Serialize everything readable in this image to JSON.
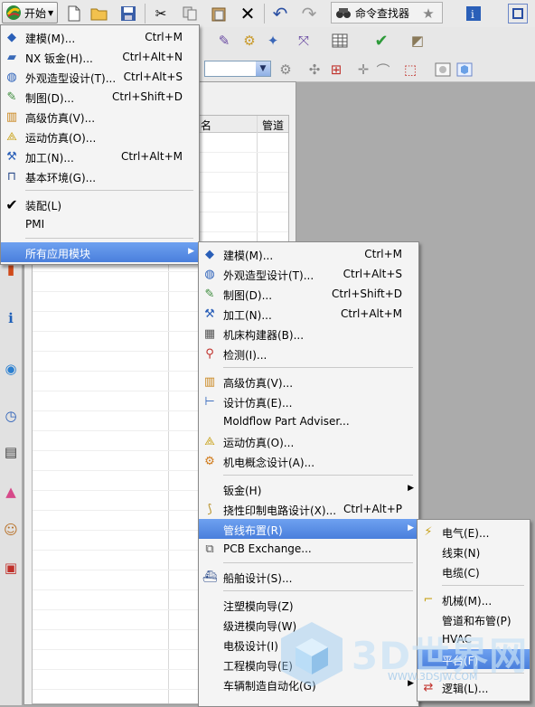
{
  "toolbar": {
    "start_label": "开始",
    "command_finder_label": "命令查找器"
  },
  "navigator": {
    "columns": [
      "名",
      "管道"
    ]
  },
  "start_menu": {
    "items": [
      {
        "label": "建模(M)...",
        "shortcut": "Ctrl+M",
        "icon": "modeling-icon"
      },
      {
        "label": "NX 钣金(H)...",
        "shortcut": "Ctrl+Alt+N",
        "icon": "sheet-metal-icon"
      },
      {
        "label": "外观造型设计(T)...",
        "shortcut": "Ctrl+Alt+S",
        "icon": "shape-studio-icon"
      },
      {
        "label": "制图(D)...",
        "shortcut": "Ctrl+Shift+D",
        "icon": "drafting-icon"
      },
      {
        "label": "高级仿真(V)...",
        "shortcut": "",
        "icon": "advanced-simulation-icon"
      },
      {
        "label": "运动仿真(O)...",
        "shortcut": "",
        "icon": "motion-simulation-icon"
      },
      {
        "label": "加工(N)...",
        "shortcut": "Ctrl+Alt+M",
        "icon": "manufacturing-icon"
      },
      {
        "label": "基本环境(G)...",
        "shortcut": "",
        "icon": "gateway-icon"
      },
      {
        "label": "装配(L)",
        "shortcut": "",
        "icon": "checkmark-icon"
      },
      {
        "label": "PMI",
        "shortcut": "",
        "icon": ""
      },
      {
        "label": "所有应用模块",
        "shortcut": "",
        "icon": ""
      }
    ]
  },
  "apps_menu": {
    "items": [
      {
        "label": "建模(M)...",
        "shortcut": "Ctrl+M"
      },
      {
        "label": "外观造型设计(T)...",
        "shortcut": "Ctrl+Alt+S"
      },
      {
        "label": "制图(D)...",
        "shortcut": "Ctrl+Shift+D"
      },
      {
        "label": "加工(N)...",
        "shortcut": "Ctrl+Alt+M"
      },
      {
        "label": "机床构建器(B)...",
        "shortcut": ""
      },
      {
        "label": "检测(I)...",
        "shortcut": ""
      },
      {
        "label": "高级仿真(V)...",
        "shortcut": ""
      },
      {
        "label": "设计仿真(E)...",
        "shortcut": ""
      },
      {
        "label": "Moldflow Part Adviser...",
        "shortcut": ""
      },
      {
        "label": "运动仿真(O)...",
        "shortcut": ""
      },
      {
        "label": "机电概念设计(A)...",
        "shortcut": ""
      },
      {
        "label": "钣金(H)",
        "shortcut": ""
      },
      {
        "label": "挠性印制电路设计(X)...",
        "shortcut": "Ctrl+Alt+P"
      },
      {
        "label": "管线布置(R)",
        "shortcut": ""
      },
      {
        "label": "PCB Exchange...",
        "shortcut": ""
      },
      {
        "label": "船舶设计(S)...",
        "shortcut": ""
      },
      {
        "label": "注塑模向导(Z)",
        "shortcut": ""
      },
      {
        "label": "级进模向导(W)",
        "shortcut": ""
      },
      {
        "label": "电极设计(I)",
        "shortcut": ""
      },
      {
        "label": "工程模向导(E)",
        "shortcut": ""
      },
      {
        "label": "车辆制造自动化(G)",
        "shortcut": ""
      }
    ]
  },
  "routing_menu": {
    "items": [
      {
        "label": "电气(E)..."
      },
      {
        "label": "线束(N)"
      },
      {
        "label": "电缆(C)"
      },
      {
        "label": "机械(M)..."
      },
      {
        "label": "管道和布管(P)"
      },
      {
        "label": "HVAC"
      },
      {
        "label": "平台(F)"
      },
      {
        "label": "逻辑(L)..."
      }
    ]
  },
  "watermark": {
    "text": "3D世界网",
    "url": "WWW.3DSJW.COM"
  },
  "colors": {
    "menu_highlight": "#4a7fdc",
    "workspace": "#ababab",
    "menu_background": "#f4f4f4"
  }
}
